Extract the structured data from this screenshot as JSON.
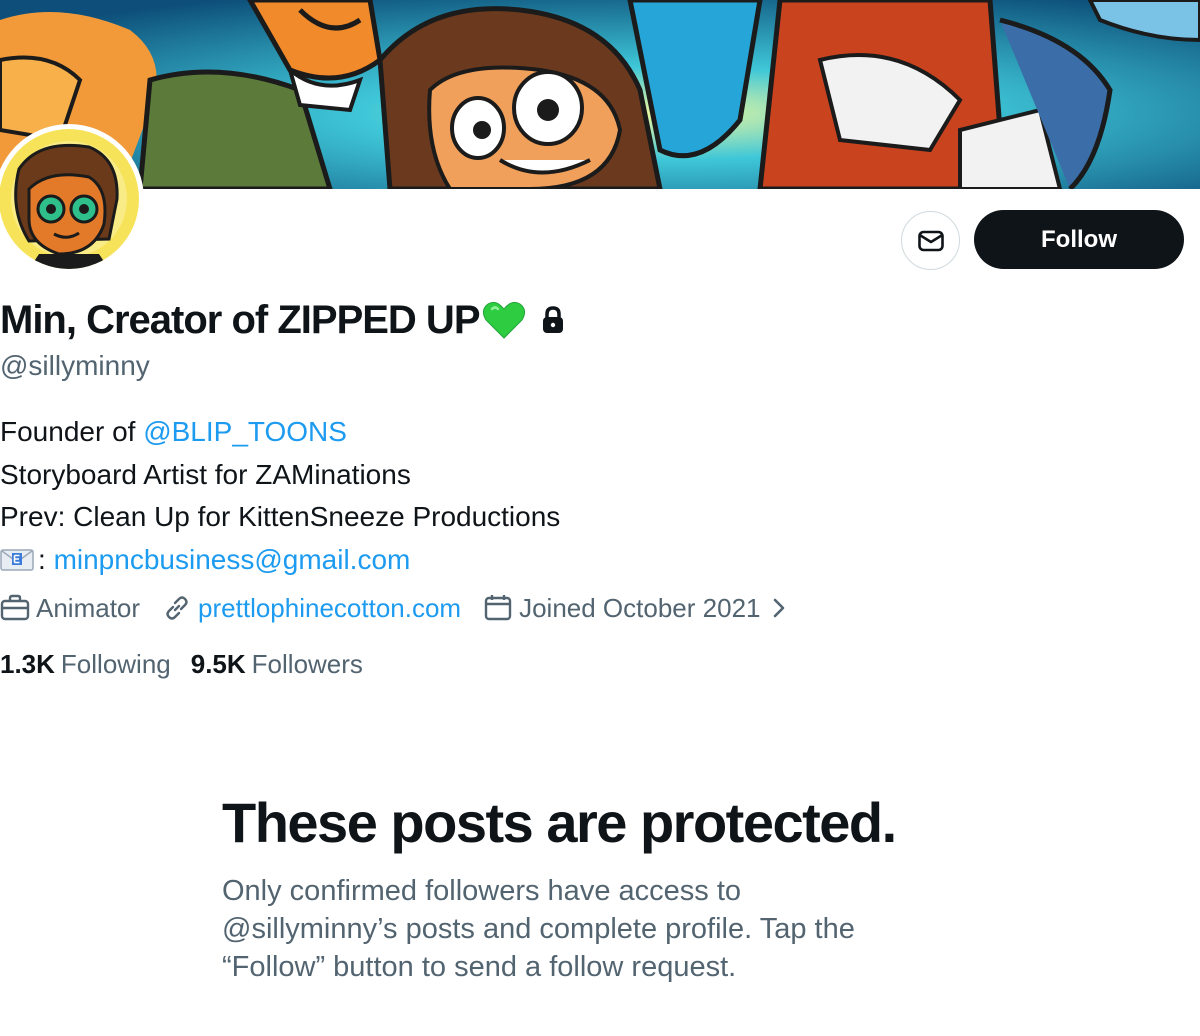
{
  "profile": {
    "display_name": "Min, Creator of ZIPPED UP",
    "handle": "@sillyminny",
    "follow_label": "Follow",
    "bio": {
      "line1_prefix": "Founder of ",
      "line1_mention": "@BLIP_TOONS",
      "line2": "Storyboard Artist for ZAMinations",
      "line3": "Prev: Clean Up for KittenSneeze Productions",
      "line4_sep": ": ",
      "line4_email": "minpncbusiness@gmail.com"
    },
    "meta": {
      "profession": "Animator",
      "website": "prettlophinecotton.com",
      "joined": "Joined October 2021"
    },
    "counts": {
      "following_value": "1.3K",
      "following_label": "Following",
      "followers_value": "9.5K",
      "followers_label": "Followers"
    }
  },
  "protected": {
    "title": "These posts are protected.",
    "desc_line1": "Only confirmed followers have access to",
    "desc_line2": "@sillyminny’s posts and complete profile. Tap the",
    "desc_line3": "“Follow” button to send a follow request."
  },
  "icons": {
    "message": "envelope-icon",
    "heart": "green-heart-icon",
    "lock": "lock-icon",
    "profession": "briefcase-icon",
    "website": "link-icon",
    "joined": "calendar-icon",
    "chevron": "chevron-right-icon",
    "email": "email-emoji-icon"
  },
  "colors": {
    "accent": "#1d9bf0",
    "text_primary": "#0f1419",
    "text_secondary": "#536471",
    "follow_bg": "#0f1419",
    "heart": "#2ecc40"
  }
}
